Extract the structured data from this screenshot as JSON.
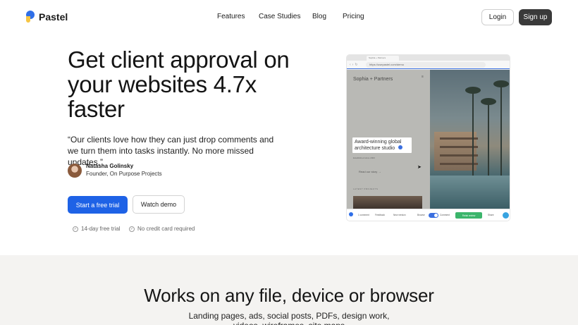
{
  "brand": {
    "name": "Pastel"
  },
  "nav": {
    "links": [
      "Features",
      "Case Studies",
      "Blog",
      "Pricing"
    ],
    "login": "Login",
    "signup": "Sign up"
  },
  "hero": {
    "title": "Get client approval on your websites 4.7x faster",
    "quote": "“Our clients love how they can just drop comments and we turn them into tasks instantly. No more missed updates.”",
    "author_name": "Natasha Golinsky",
    "author_role": "Founder, On Purpose Projects",
    "cta_primary": "Start a free trial",
    "cta_secondary": "Watch demo",
    "perks": [
      "14-day free trial",
      "No credit card required"
    ]
  },
  "mock": {
    "tab_label": "Sophia + Partners",
    "url": "https://usepastel.com/demo",
    "site_brand": "Sophia + Partners",
    "comment_text": "Award-winning global architecture studio",
    "small_text": "Established since 2003",
    "link_text": "Read our story →",
    "latest_label": "LATEST PROJECTS",
    "toolbar": {
      "comment": "1 comment",
      "feedback": "Feedback",
      "new_version": "New version",
      "browse": "Browse",
      "comment_mode": "Comment",
      "finish": "Finish review",
      "share": "Share"
    }
  },
  "section2": {
    "title": "Works on any file, device or browser",
    "subtitle": "Landing pages, ads, social posts, PDFs, design work, videos, wireframes, site maps"
  },
  "colors": {
    "primary_blue": "#1e62e6",
    "dark_button": "#3a3a3a",
    "section_bg": "#f4f3f1"
  }
}
